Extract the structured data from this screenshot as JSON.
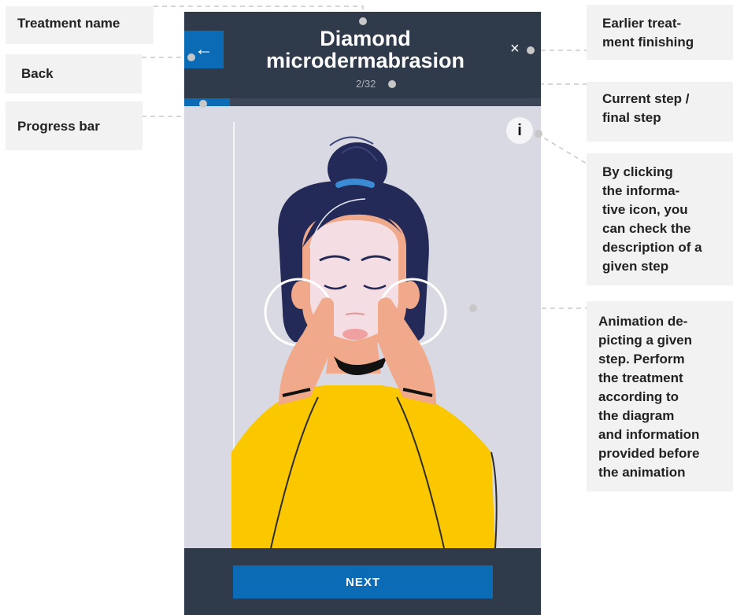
{
  "header": {
    "title_line1": "Diamond",
    "title_line2": "microdermabrasion",
    "back_icon": "←",
    "close_icon": "×",
    "step_counter": "2/32"
  },
  "progress": {
    "current_step": 2,
    "total_steps": 32
  },
  "info_icon": "i",
  "footer": {
    "next_label": "NEXT"
  },
  "annotations": {
    "treatment_name": "Treatment name",
    "back": "Back",
    "progress_bar": "Progress bar",
    "finish": [
      "Earlier treat-",
      "ment finishing"
    ],
    "step": [
      "Current step /",
      "final step"
    ],
    "info": [
      "By clicking",
      "the informa-",
      "tive icon, you",
      "can check the",
      "description of a",
      "given step"
    ],
    "animation": [
      "Animation de-",
      "picting a given",
      "step. Perform",
      "the treatment",
      "according to",
      "the diagram",
      "and information",
      "provided before",
      "the animation"
    ]
  },
  "colors": {
    "accent": "#0b6bb4",
    "panel": "#2f3a4a",
    "illustration_bg": "#d9d9e3",
    "sweater": "#fbc800",
    "hair": "#232a57"
  }
}
